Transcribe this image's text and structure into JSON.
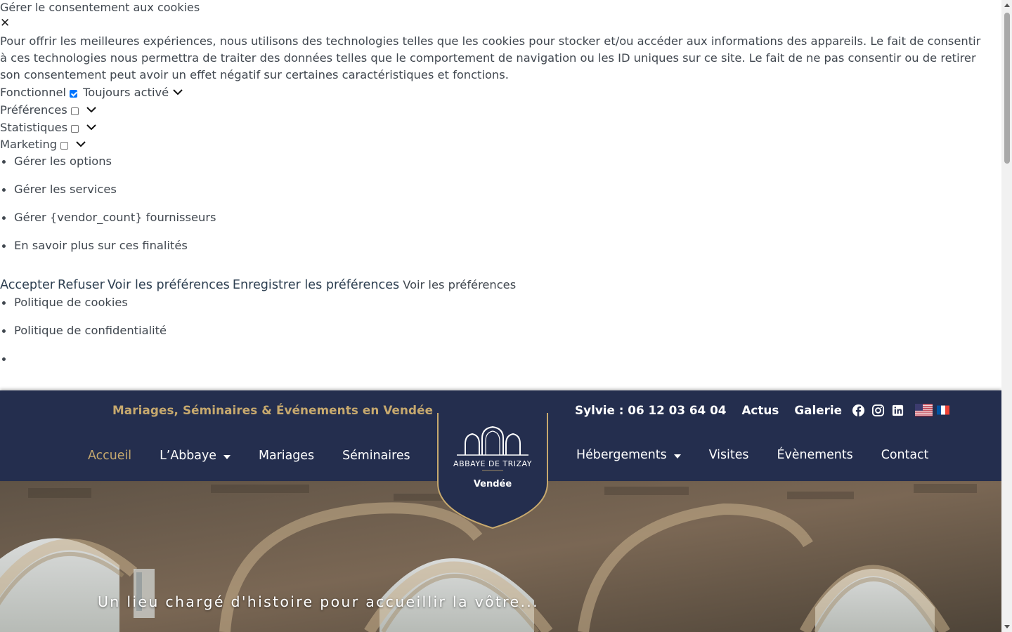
{
  "cookie_banner": {
    "title": "Gérer le consentement aux cookies",
    "close_icon": "close-icon",
    "message": "Pour offrir les meilleures expériences, nous utilisons des technologies telles que les cookies pour stocker et/ou accéder aux informations des appareils. Le fait de consentir à ces technologies nous permettra de traiter des données telles que le comportement de navigation ou les ID uniques sur ce site. Le fait de ne pas consentir ou de retirer son consentement peut avoir un effet négatif sur certaines caractéristiques et fonctions.",
    "categories": [
      {
        "label": "Fonctionnel",
        "checked": true,
        "status": "Toujours activé"
      },
      {
        "label": "Préférences",
        "checked": false
      },
      {
        "label": "Statistiques",
        "checked": false
      },
      {
        "label": "Marketing",
        "checked": false
      }
    ],
    "manage_links": [
      "Gérer les options",
      "Gérer les services",
      "Gérer {vendor_count} fournisseurs",
      "En savoir plus sur ces finalités"
    ],
    "buttons": {
      "accept": "Accepter",
      "refuse": "Refuser",
      "view_preferences": "Voir les préférences",
      "save_preferences": "Enregistrer les préférences",
      "view_preferences_link": "Voir les préférences"
    },
    "policy_links": [
      "Politique de cookies",
      "Politique de confidentialité",
      ""
    ]
  },
  "header": {
    "tagline": "Mariages, Séminaires & Événements en Vendée",
    "phone": "Sylvie : 06 12 03 64 04",
    "top_links": [
      "Actus",
      "Galerie"
    ],
    "social_icons": [
      "facebook-icon",
      "instagram-icon",
      "linkedin-icon"
    ],
    "languages": [
      "English",
      "Français"
    ],
    "nav_left": [
      {
        "label": "Accueil",
        "active": true,
        "dropdown": false
      },
      {
        "label": "L’Abbaye",
        "active": false,
        "dropdown": true
      },
      {
        "label": "Mariages",
        "active": false,
        "dropdown": false
      },
      {
        "label": "Séminaires",
        "active": false,
        "dropdown": false
      }
    ],
    "nav_right": [
      {
        "label": "Hébergements",
        "active": false,
        "dropdown": true
      },
      {
        "label": "Visites",
        "active": false,
        "dropdown": false
      },
      {
        "label": "Évènements",
        "active": false,
        "dropdown": false
      },
      {
        "label": "Contact",
        "active": false,
        "dropdown": false
      }
    ],
    "logo": {
      "name": "ABBAYE DE TRIZAY",
      "subtitle": "Vendée"
    }
  },
  "hero": {
    "caption": "Un lieu chargé d'histoire pour accueillir la vôtre..."
  },
  "colors": {
    "navy": "#242e4e",
    "gold": "#c7a96e",
    "text": "#40474f"
  }
}
